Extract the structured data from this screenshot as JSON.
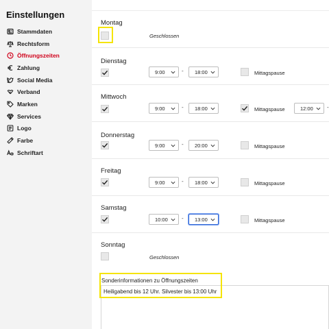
{
  "sidebar": {
    "title": "Einstellungen",
    "items": [
      {
        "label": "Stammdaten",
        "icon": "id-card-icon",
        "active": false
      },
      {
        "label": "Rechtsform",
        "icon": "scale-icon",
        "active": false
      },
      {
        "label": "Öffnungszeiten",
        "icon": "clock-icon",
        "active": true
      },
      {
        "label": "Zahlung",
        "icon": "euro-icon",
        "active": false
      },
      {
        "label": "Social Media",
        "icon": "twitter-icon",
        "active": false
      },
      {
        "label": "Verband",
        "icon": "handshake-icon",
        "active": false
      },
      {
        "label": "Marken",
        "icon": "tag-icon",
        "active": false
      },
      {
        "label": "Services",
        "icon": "diamond-icon",
        "active": false
      },
      {
        "label": "Logo",
        "icon": "image-icon",
        "active": false
      },
      {
        "label": "Farbe",
        "icon": "palette-icon",
        "active": false
      },
      {
        "label": "Schriftart",
        "icon": "font-icon",
        "active": false
      }
    ]
  },
  "days": [
    {
      "name": "Montag",
      "open": false,
      "closed_label": "Geschlossen"
    },
    {
      "name": "Dienstag",
      "open": true,
      "from": "9:00",
      "to": "18:00",
      "pause": false,
      "pause_label": "Mittagspause"
    },
    {
      "name": "Mittwoch",
      "open": true,
      "from": "9:00",
      "to": "18:00",
      "pause": true,
      "pause_label": "Mittagspause",
      "pause_from": "12:00"
    },
    {
      "name": "Donnerstag",
      "open": true,
      "from": "9:00",
      "to": "20:00",
      "pause": false,
      "pause_label": "Mittagspause"
    },
    {
      "name": "Freitag",
      "open": true,
      "from": "9:00",
      "to": "18:00",
      "pause": false,
      "pause_label": "Mittagspause"
    },
    {
      "name": "Samstag",
      "open": true,
      "from": "10:00",
      "to": "13:00",
      "pause": false,
      "pause_label": "Mittagspause"
    },
    {
      "name": "Sonntag",
      "open": false,
      "closed_label": "Geschlossen"
    }
  ],
  "separator": "-",
  "special_info": {
    "label": "Sonderinformationen zu Öffnungszeiten",
    "value": "Heiligabend bis 12 Uhr. Silvester bis 13:00 Uhr"
  },
  "colors": {
    "active_nav": "#d0021b",
    "highlight": "#f5e400",
    "focus": "#3367d6"
  }
}
